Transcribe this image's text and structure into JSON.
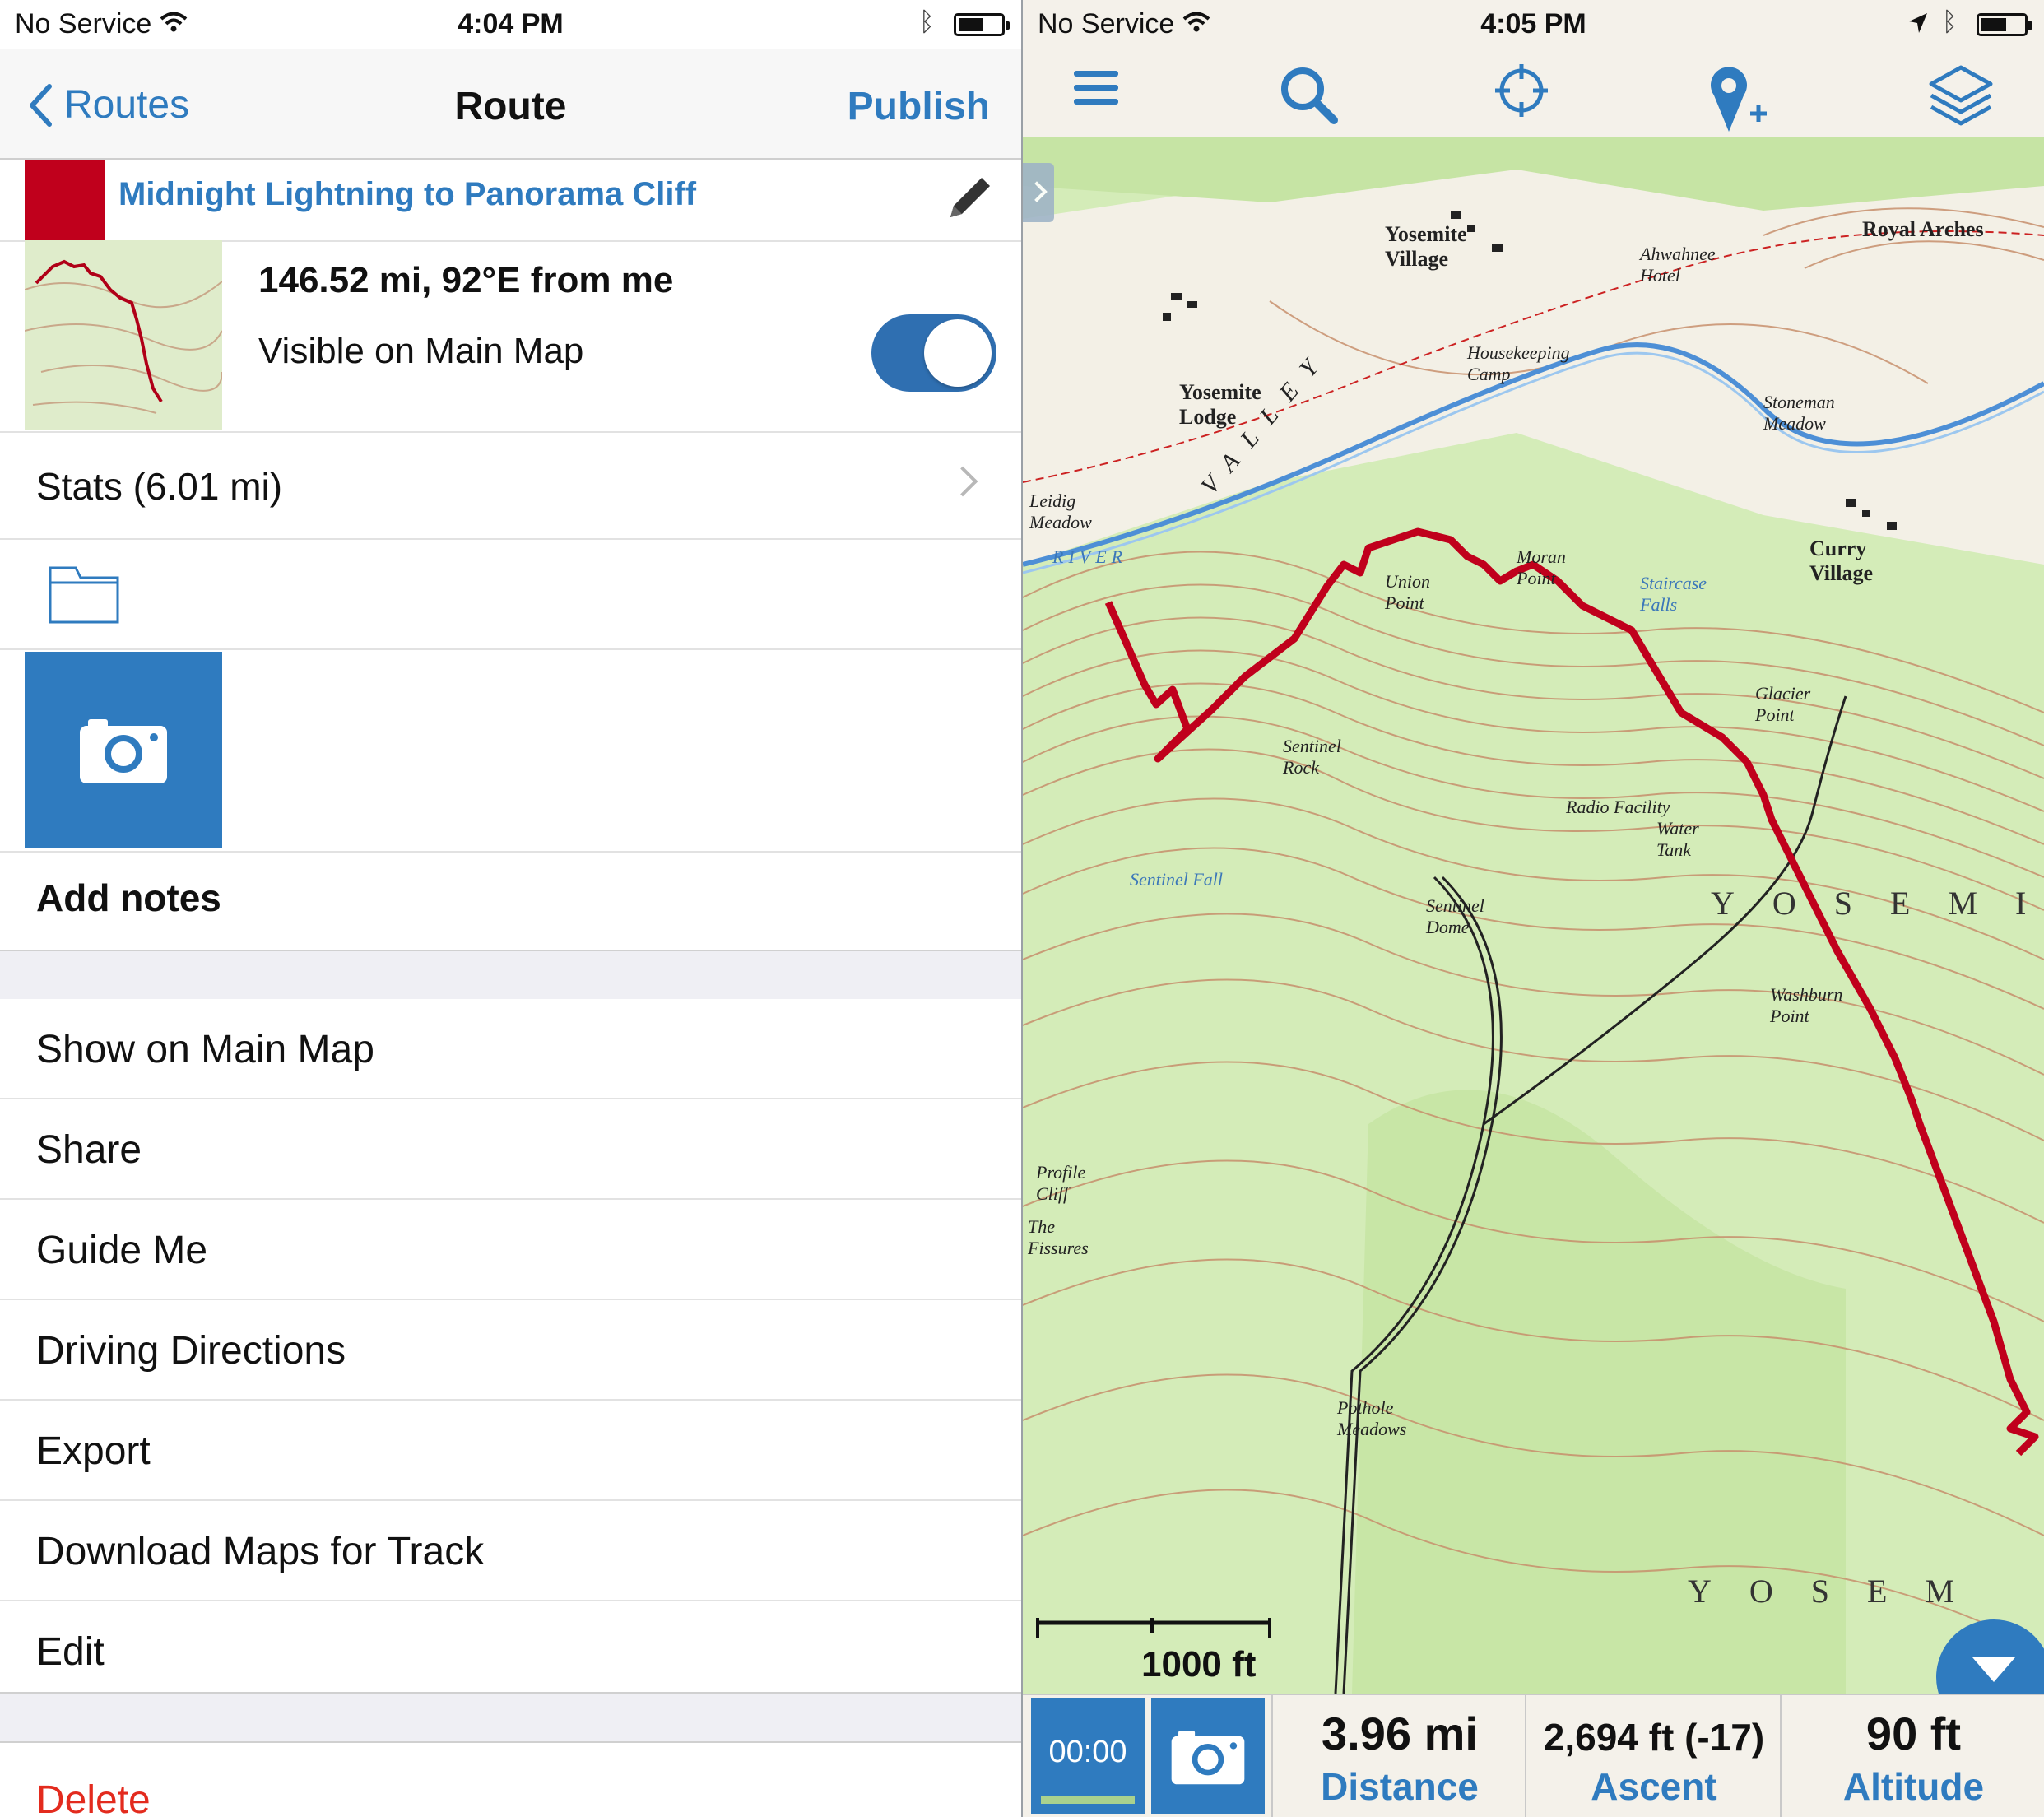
{
  "left": {
    "status": {
      "carrier": "No Service",
      "time": "4:04 PM"
    },
    "nav": {
      "back": "Routes",
      "title": "Route",
      "action": "Publish"
    },
    "route": {
      "name": "Midnight Lightning to Panorama Cliff",
      "color": "#c0001c",
      "distance": "146.52 mi, 92°E from me",
      "visible_label": "Visible on Main Map",
      "visible": true
    },
    "stats_label": "Stats (6.01 mi)",
    "notes_label": "Add notes",
    "menu": [
      "Show on Main Map",
      "Share",
      "Guide Me",
      "Driving Directions",
      "Export",
      "Download Maps for Track",
      "Edit"
    ],
    "delete_label": "Delete"
  },
  "right": {
    "status": {
      "carrier": "No Service",
      "time": "4:05 PM"
    },
    "toolbar": [
      "menu-icon",
      "search-icon",
      "locate-icon",
      "add-waypoint-icon",
      "layers-icon"
    ],
    "map_labels": [
      {
        "t": "Yosemite Village",
        "big": true
      },
      {
        "t": "Yosemite Lodge",
        "big": true
      },
      {
        "t": "Curry Village",
        "big": true
      },
      {
        "t": "Royal Arches",
        "big": true
      },
      {
        "t": "Union Point"
      },
      {
        "t": "Moran Point"
      },
      {
        "t": "Glacier Point"
      },
      {
        "t": "Sentinel Rock"
      },
      {
        "t": "Sentinel Dome"
      },
      {
        "t": "Washburn Point"
      },
      {
        "t": "Profile Cliff"
      },
      {
        "t": "The Fissures"
      },
      {
        "t": "Pothole Meadows"
      },
      {
        "t": "Leidig Meadow"
      },
      {
        "t": "Housekeeping Camp"
      },
      {
        "t": "Ahwahnee Hotel"
      },
      {
        "t": "Stoneman Meadow"
      },
      {
        "t": "Radio Facility"
      },
      {
        "t": "Water Tank"
      },
      {
        "t": "Staircase Falls",
        "blue": true
      },
      {
        "t": "Sentinel Fall",
        "blue": true
      },
      {
        "t": "RIVER",
        "blue": true
      },
      {
        "t": "VALLEY"
      },
      {
        "t": "YOSEMI"
      },
      {
        "t": "YOSEM"
      }
    ],
    "scale_label": "1000 ft",
    "timer": "00:00",
    "stats": [
      {
        "value": "3.96 mi",
        "label": "Distance"
      },
      {
        "value": "2,694 ft (-17)",
        "label": "Ascent"
      },
      {
        "value": "90 ft",
        "label": "Altitude"
      }
    ]
  },
  "colors": {
    "accent": "#2f7bbf",
    "route": "#c0001c",
    "delete": "#e32b1e"
  }
}
